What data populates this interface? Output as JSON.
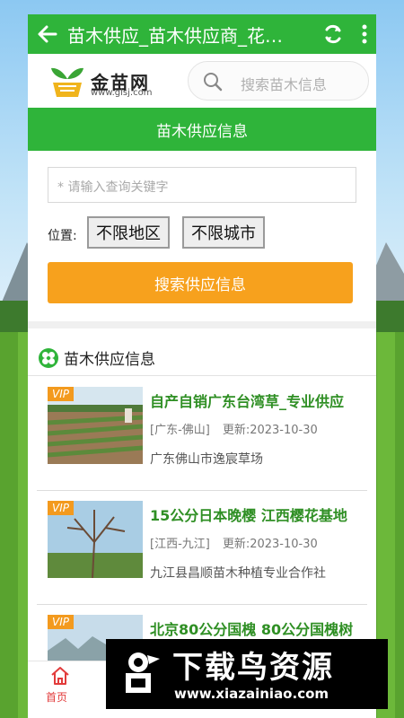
{
  "titlebar": {
    "title": "苗木供应_苗木供应商_花…",
    "back_icon": "back-arrow-icon",
    "refresh_icon": "refresh-icon",
    "more_icon": "more-vertical-icon"
  },
  "brand": {
    "name": "金苗网",
    "url": "www.glsj.com"
  },
  "search": {
    "placeholder": "搜索苗木信息"
  },
  "section_bar": {
    "title": "苗木供应信息"
  },
  "query": {
    "placeholder": "* 请输入查询关键字"
  },
  "location": {
    "label": "位置:",
    "region_button": "不限地区",
    "city_button": "不限城市"
  },
  "search_button": "搜索供应信息",
  "list_section": {
    "title": "苗木供应信息",
    "icon": "clover-icon"
  },
  "items": [
    {
      "vip": "VIP",
      "title": "自产自销广东台湾草_专业供应",
      "region": "[广东-佛山]",
      "date": "更新:2023-10-30",
      "seller": "广东佛山市逸宸草场"
    },
    {
      "vip": "VIP",
      "title": "15公分日本晚樱 江西樱花基地",
      "region": "[江西-九江]",
      "date": "更新:2023-10-30",
      "seller": "九江县昌顺苗木种植专业合作社"
    },
    {
      "vip": "VIP",
      "title": "北京80公分国槐 80公分国槐树",
      "region": "",
      "date": "",
      "seller": ""
    }
  ],
  "bottom_nav": {
    "home_label": "首页",
    "home_color": "#e23b3b"
  },
  "watermark": {
    "main": "下载鸟资源",
    "url": "www.xiazainiao.com"
  },
  "colors": {
    "primary_green": "#2fb43a",
    "orange": "#f7a11d",
    "title_green": "#2f8f24"
  }
}
